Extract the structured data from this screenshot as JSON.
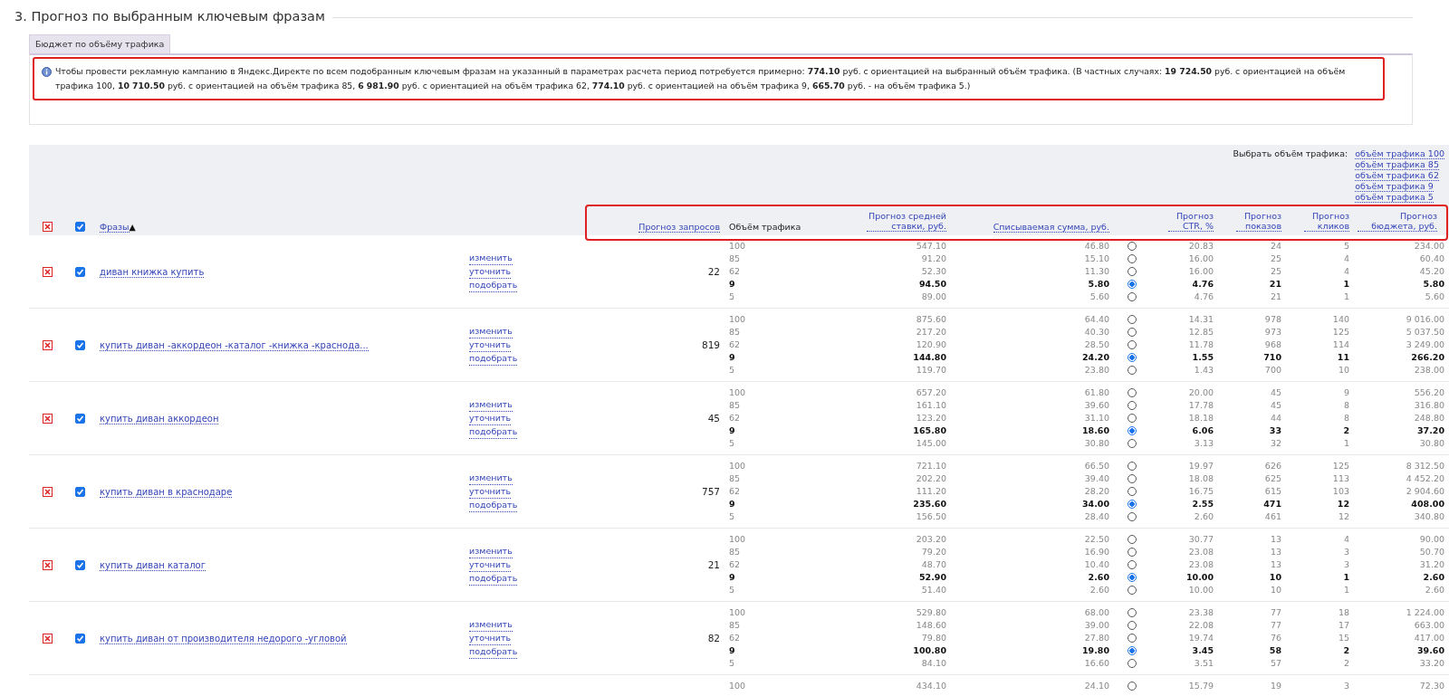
{
  "section_title": "3. Прогноз по выбранным ключевым фразам",
  "tabs": [
    {
      "label": "Бюджет по объёму трафика",
      "selected": true
    }
  ],
  "info": {
    "highlighted": true,
    "text": "Чтобы провести рекламную кампанию в Яндекс.Директе по всем подобранным ключевым фразам на указанный в параметрах расчета период потребуется примерно: **774.10** руб. с ориентацией на выбранный объём трафика. (В частных случаях: **19 724.50** руб. с ориентацией на объём трафика 100, **10 710.50** руб. с ориентацией на объём трафика 85, **6 981.90** руб. с ориентацией на объём трафика 62, **774.10** руб. с ориентацией на объём трафика 9, **665.70** руб. - на объём трафика 5.)"
  },
  "table": {
    "traffic_picker": {
      "label": "Выбрать объём трафика:",
      "options": [
        "объём трафика 100",
        "объём трафика 85",
        "объём трафика 62",
        "объём трафика 9",
        "объём трафика 5"
      ]
    },
    "header": {
      "all_checked": true,
      "highlighted": true,
      "phrase": "Фразы",
      "sort": "▲",
      "columns": [
        {
          "label": "Прогноз запросов",
          "kind": "link"
        },
        {
          "label": "Объём трафика",
          "kind": "text"
        },
        {
          "label": "Прогноз средней ставки, руб.",
          "kind": "link"
        },
        {
          "label": "Списываемая сумма, руб.",
          "kind": "link"
        },
        {
          "label": "Прогноз CTR, %",
          "kind": "link"
        },
        {
          "label": "Прогноз показов",
          "kind": "link"
        },
        {
          "label": "Прогноз кликов",
          "kind": "link"
        },
        {
          "label": "Прогноз бюджета, руб.",
          "kind": "link"
        }
      ]
    },
    "rows": [
      {
        "phrase": "диван книжка купить",
        "checked": true,
        "actions": [
          "изменить",
          "уточнить",
          "подобрать"
        ],
        "requests": "22",
        "levels": [
          {
            "traffic": "100",
            "bid": "547.10",
            "charge": "46.80",
            "ctr": "20.83",
            "shows": "24",
            "clicks": "5",
            "budget": "234.00",
            "selected": false
          },
          {
            "traffic": "85",
            "bid": "91.20",
            "charge": "15.10",
            "ctr": "16.00",
            "shows": "25",
            "clicks": "4",
            "budget": "60.40",
            "selected": false
          },
          {
            "traffic": "62",
            "bid": "52.30",
            "charge": "11.30",
            "ctr": "16.00",
            "shows": "25",
            "clicks": "4",
            "budget": "45.20",
            "selected": false
          },
          {
            "traffic": "9",
            "bid": "94.50",
            "charge": "5.80",
            "ctr": "4.76",
            "shows": "21",
            "clicks": "1",
            "budget": "5.80",
            "selected": true
          },
          {
            "traffic": "5",
            "bid": "89.00",
            "charge": "5.60",
            "ctr": "4.76",
            "shows": "21",
            "clicks": "1",
            "budget": "5.60",
            "selected": false
          }
        ]
      },
      {
        "phrase": "купить диван -аккордеон -каталог -книжка -краснода...",
        "checked": true,
        "actions": [
          "изменить",
          "уточнить",
          "подобрать"
        ],
        "requests": "819",
        "levels": [
          {
            "traffic": "100",
            "bid": "875.60",
            "charge": "64.40",
            "ctr": "14.31",
            "shows": "978",
            "clicks": "140",
            "budget": "9 016.00",
            "selected": false
          },
          {
            "traffic": "85",
            "bid": "217.20",
            "charge": "40.30",
            "ctr": "12.85",
            "shows": "973",
            "clicks": "125",
            "budget": "5 037.50",
            "selected": false
          },
          {
            "traffic": "62",
            "bid": "120.90",
            "charge": "28.50",
            "ctr": "11.78",
            "shows": "968",
            "clicks": "114",
            "budget": "3 249.00",
            "selected": false
          },
          {
            "traffic": "9",
            "bid": "144.80",
            "charge": "24.20",
            "ctr": "1.55",
            "shows": "710",
            "clicks": "11",
            "budget": "266.20",
            "selected": true
          },
          {
            "traffic": "5",
            "bid": "119.70",
            "charge": "23.80",
            "ctr": "1.43",
            "shows": "700",
            "clicks": "10",
            "budget": "238.00",
            "selected": false
          }
        ]
      },
      {
        "phrase": "купить диван аккордеон",
        "checked": true,
        "actions": [
          "изменить",
          "уточнить",
          "подобрать"
        ],
        "requests": "45",
        "levels": [
          {
            "traffic": "100",
            "bid": "657.20",
            "charge": "61.80",
            "ctr": "20.00",
            "shows": "45",
            "clicks": "9",
            "budget": "556.20",
            "selected": false
          },
          {
            "traffic": "85",
            "bid": "161.10",
            "charge": "39.60",
            "ctr": "17.78",
            "shows": "45",
            "clicks": "8",
            "budget": "316.80",
            "selected": false
          },
          {
            "traffic": "62",
            "bid": "123.20",
            "charge": "31.10",
            "ctr": "18.18",
            "shows": "44",
            "clicks": "8",
            "budget": "248.80",
            "selected": false
          },
          {
            "traffic": "9",
            "bid": "165.80",
            "charge": "18.60",
            "ctr": "6.06",
            "shows": "33",
            "clicks": "2",
            "budget": "37.20",
            "selected": true
          },
          {
            "traffic": "5",
            "bid": "145.00",
            "charge": "30.80",
            "ctr": "3.13",
            "shows": "32",
            "clicks": "1",
            "budget": "30.80",
            "selected": false
          }
        ]
      },
      {
        "phrase": "купить диван в краснодаре",
        "checked": true,
        "actions": [
          "изменить",
          "уточнить",
          "подобрать"
        ],
        "requests": "757",
        "levels": [
          {
            "traffic": "100",
            "bid": "721.10",
            "charge": "66.50",
            "ctr": "19.97",
            "shows": "626",
            "clicks": "125",
            "budget": "8 312.50",
            "selected": false
          },
          {
            "traffic": "85",
            "bid": "202.20",
            "charge": "39.40",
            "ctr": "18.08",
            "shows": "625",
            "clicks": "113",
            "budget": "4 452.20",
            "selected": false
          },
          {
            "traffic": "62",
            "bid": "111.20",
            "charge": "28.20",
            "ctr": "16.75",
            "shows": "615",
            "clicks": "103",
            "budget": "2 904.60",
            "selected": false
          },
          {
            "traffic": "9",
            "bid": "235.60",
            "charge": "34.00",
            "ctr": "2.55",
            "shows": "471",
            "clicks": "12",
            "budget": "408.00",
            "selected": true
          },
          {
            "traffic": "5",
            "bid": "156.50",
            "charge": "28.40",
            "ctr": "2.60",
            "shows": "461",
            "clicks": "12",
            "budget": "340.80",
            "selected": false
          }
        ]
      },
      {
        "phrase": "купить диван каталог",
        "checked": true,
        "actions": [
          "изменить",
          "уточнить",
          "подобрать"
        ],
        "requests": "21",
        "levels": [
          {
            "traffic": "100",
            "bid": "203.20",
            "charge": "22.50",
            "ctr": "30.77",
            "shows": "13",
            "clicks": "4",
            "budget": "90.00",
            "selected": false
          },
          {
            "traffic": "85",
            "bid": "79.20",
            "charge": "16.90",
            "ctr": "23.08",
            "shows": "13",
            "clicks": "3",
            "budget": "50.70",
            "selected": false
          },
          {
            "traffic": "62",
            "bid": "48.70",
            "charge": "10.40",
            "ctr": "23.08",
            "shows": "13",
            "clicks": "3",
            "budget": "31.20",
            "selected": false
          },
          {
            "traffic": "9",
            "bid": "52.90",
            "charge": "2.60",
            "ctr": "10.00",
            "shows": "10",
            "clicks": "1",
            "budget": "2.60",
            "selected": true
          },
          {
            "traffic": "5",
            "bid": "51.40",
            "charge": "2.60",
            "ctr": "10.00",
            "shows": "10",
            "clicks": "1",
            "budget": "2.60",
            "selected": false
          }
        ]
      },
      {
        "phrase": "купить диван от производителя недорого -угловой",
        "checked": true,
        "actions": [
          "изменить",
          "уточнить",
          "подобрать"
        ],
        "requests": "82",
        "levels": [
          {
            "traffic": "100",
            "bid": "529.80",
            "charge": "68.00",
            "ctr": "23.38",
            "shows": "77",
            "clicks": "18",
            "budget": "1 224.00",
            "selected": false
          },
          {
            "traffic": "85",
            "bid": "148.60",
            "charge": "39.00",
            "ctr": "22.08",
            "shows": "77",
            "clicks": "17",
            "budget": "663.00",
            "selected": false
          },
          {
            "traffic": "62",
            "bid": "79.80",
            "charge": "27.80",
            "ctr": "19.74",
            "shows": "76",
            "clicks": "15",
            "budget": "417.00",
            "selected": false
          },
          {
            "traffic": "9",
            "bid": "100.80",
            "charge": "19.80",
            "ctr": "3.45",
            "shows": "58",
            "clicks": "2",
            "budget": "39.60",
            "selected": true
          },
          {
            "traffic": "5",
            "bid": "84.10",
            "charge": "16.60",
            "ctr": "3.51",
            "shows": "57",
            "clicks": "2",
            "budget": "33.20",
            "selected": false
          }
        ]
      },
      {
        "levels": [
          {
            "traffic": "100",
            "bid": "434.10",
            "charge": "24.10",
            "ctr": "15.79",
            "shows": "19",
            "clicks": "3",
            "budget": "72.30",
            "selected": false
          }
        ]
      }
    ]
  }
}
